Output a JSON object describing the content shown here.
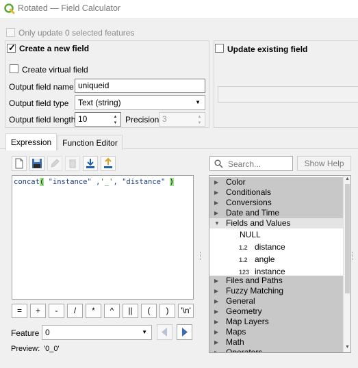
{
  "window": {
    "title": "Rotated — Field Calculator"
  },
  "only_update": {
    "label": "Only update 0 selected features"
  },
  "create_new": {
    "label": "Create a new field",
    "checked": true
  },
  "update_existing": {
    "label": "Update existing field"
  },
  "virtual": {
    "label": "Create virtual field"
  },
  "output_name": {
    "label": "Output field name",
    "value": "uniqueid"
  },
  "output_type": {
    "label": "Output field type",
    "value": "Text (string)"
  },
  "output_length": {
    "label": "Output field length",
    "value": "10"
  },
  "precision": {
    "label": "Precision",
    "value": "3"
  },
  "tabs": [
    {
      "label": "Expression"
    },
    {
      "label": "Function Editor"
    }
  ],
  "expression": {
    "func": "concat",
    "open": "(",
    "a": "\"instance\"",
    "sep1": ",",
    "b": "'_'",
    "sep2": ",",
    "c": "\"distance\"",
    "close": ")"
  },
  "operators": [
    "=",
    "+",
    "-",
    "/",
    "*",
    "^",
    "||",
    "(",
    ")",
    "'\\n'"
  ],
  "feature": {
    "label": "Feature",
    "value": "0"
  },
  "preview": {
    "label": "Preview:",
    "value": "'0_0'"
  },
  "search": {
    "placeholder": "Search..."
  },
  "show_help": {
    "label": "Show Help"
  },
  "tree_top": [
    "Color",
    "Conditionals",
    "Conversions",
    "Date and Time"
  ],
  "tree_open": "Fields and Values",
  "tree_leaves": [
    {
      "type": "",
      "label": "NULL"
    },
    {
      "type": "1.2",
      "label": "distance"
    },
    {
      "type": "1.2",
      "label": "angle"
    },
    {
      "type": "123",
      "label": "instance"
    }
  ],
  "tree_bottom": [
    "Files and Paths",
    "Fuzzy Matching",
    "General",
    "Geometry",
    "Map Layers",
    "Maps",
    "Math",
    "Operators"
  ],
  "colors": {
    "accent_green": "#9fe58f",
    "tree_grey": "#c8c8c8",
    "text_blue": "#1a3c8a"
  }
}
